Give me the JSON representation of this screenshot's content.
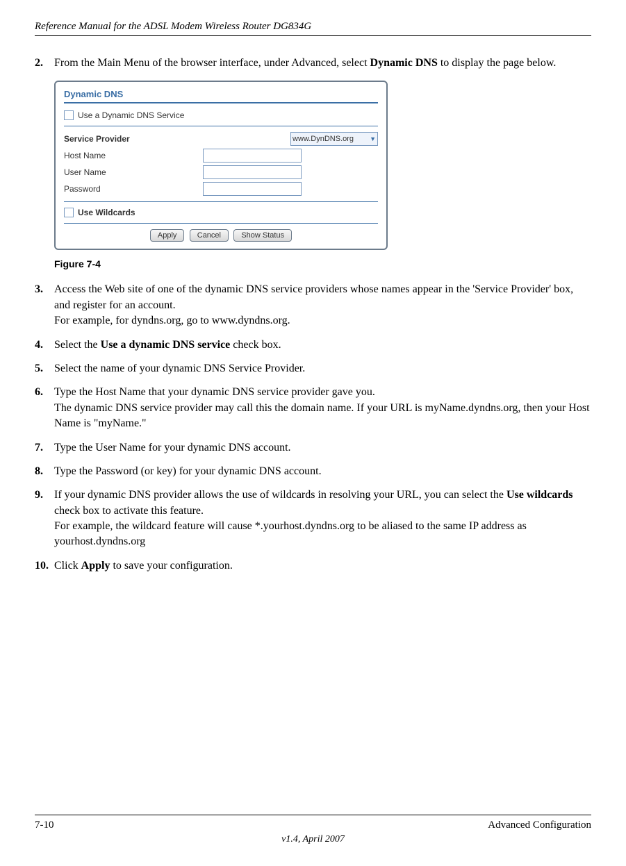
{
  "header": {
    "title": "Reference Manual for the ADSL Modem Wireless Router DG834G"
  },
  "steps": [
    {
      "num": "2.",
      "text_before": "From the Main Menu of the browser interface, under Advanced, select ",
      "bold": "Dynamic DNS",
      "text_after": " to display the page below."
    }
  ],
  "figure": {
    "panel_title": "Dynamic DNS",
    "use_service_label": "Use a Dynamic DNS Service",
    "service_provider_label": "Service Provider",
    "service_provider_value": "www.DynDNS.org",
    "host_name_label": "Host Name",
    "user_name_label": "User Name",
    "password_label": "Password",
    "use_wildcards_label": "Use Wildcards",
    "buttons": {
      "apply": "Apply",
      "cancel": "Cancel",
      "show_status": "Show Status"
    },
    "caption": "Figure 7-4"
  },
  "steps_after": [
    {
      "num": "3.",
      "lines": [
        "Access the Web site of one of the dynamic DNS service providers whose names appear in the 'Service Provider' box, and register for an account.",
        "For example, for dyndns.org, go to www.dyndns.org."
      ]
    },
    {
      "num": "4.",
      "pre": "Select the ",
      "bold": "Use a dynamic DNS service",
      "post": " check box."
    },
    {
      "num": "5.",
      "plain": "Select the name of your dynamic DNS Service Provider."
    },
    {
      "num": "6.",
      "lines": [
        "Type the Host Name that your dynamic DNS service provider gave you.",
        "The dynamic DNS service provider may call this the domain name. If your URL is myName.dyndns.org, then your Host Name is \"myName.\""
      ]
    },
    {
      "num": "7.",
      "plain": "Type the User Name for your dynamic DNS account."
    },
    {
      "num": "8.",
      "plain": "Type the Password (or key) for your dynamic DNS account."
    },
    {
      "num": "9.",
      "pre": "If your dynamic DNS provider allows the use of wildcards in resolving your URL, you can select the ",
      "bold": "Use wildcards",
      "post": " check box to activate this feature.",
      "extra": "For example, the wildcard feature will cause *.yourhost.dyndns.org to be aliased to the same IP address as yourhost.dyndns.org"
    },
    {
      "num": "10.",
      "pre": "Click ",
      "bold": "Apply",
      "post": " to save your configuration."
    }
  ],
  "footer": {
    "left": "7-10",
    "right": "Advanced Configuration",
    "center": "v1.4, April 2007"
  }
}
